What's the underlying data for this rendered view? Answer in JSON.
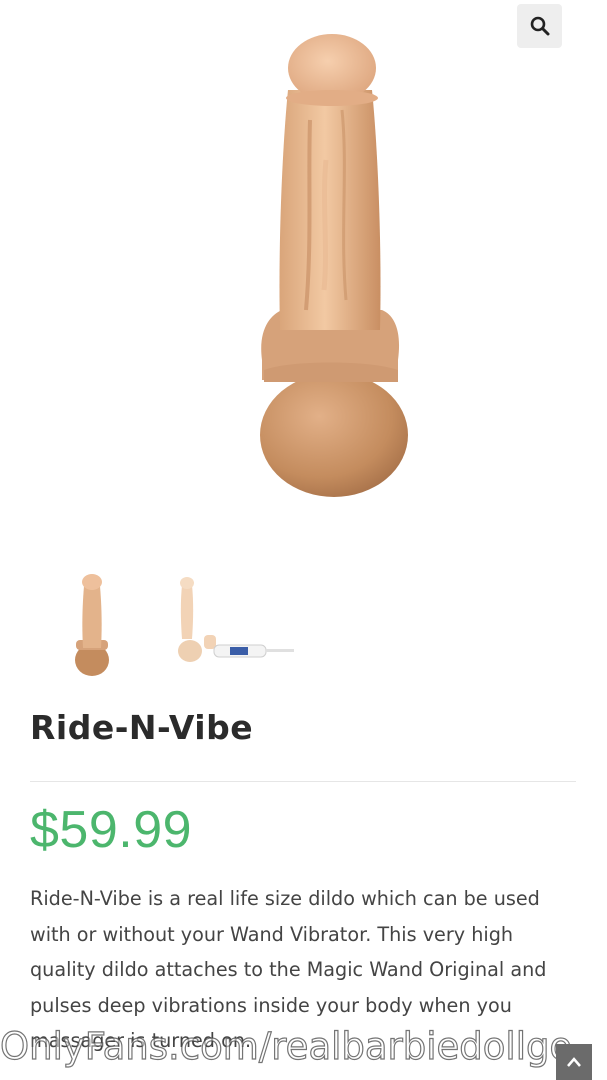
{
  "header": {
    "search_icon": "search-icon"
  },
  "gallery": {
    "main_image": "dildo-product-image",
    "thumbnails": [
      "thumbnail-dildo",
      "thumbnail-dildo-with-wand"
    ]
  },
  "product": {
    "title": "Ride-N-Vibe",
    "price": "$59.99",
    "description": "Ride-N-Vibe is a real life size dildo which can be used with or without your Wand Vibrator.  This very high quality dildo attaches to the Magic Wand Original and pulses deep vibrations inside your body when you massager is turned on."
  },
  "watermark": {
    "text": "OnlyFans.com/realbarbiedollgo"
  },
  "colors": {
    "price": "#4cb66d",
    "title": "#2b2b2b",
    "body_text": "#444444",
    "search_button_bg": "#eeeeee",
    "scroll_button_bg": "#6b6b6b"
  },
  "scroll_top": {
    "icon": "chevron-up-icon"
  }
}
